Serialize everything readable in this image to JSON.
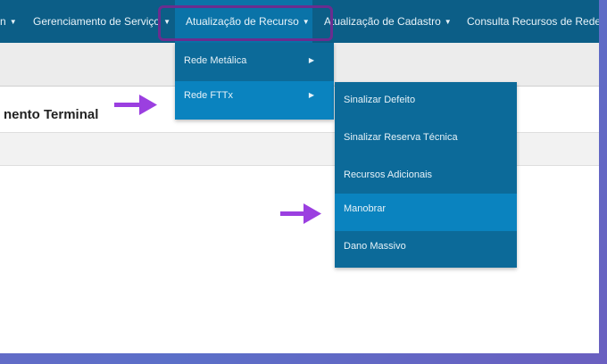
{
  "nav": {
    "items": [
      {
        "label": "n",
        "caret": "▼"
      },
      {
        "label": "Gerenciamento de Serviço",
        "caret": "▼"
      },
      {
        "label": "Atualização de Recurso",
        "caret": "▼"
      },
      {
        "label": "Atualização de Cadastro",
        "caret": "▼"
      },
      {
        "label": "Consulta Recursos de Rede",
        "caret": ""
      }
    ]
  },
  "page": {
    "title": "nento Terminal"
  },
  "menu_level1": {
    "items": [
      {
        "label": "Rede Metálica",
        "arrow": "▶"
      },
      {
        "label": "Rede FTTx",
        "arrow": "▶"
      }
    ]
  },
  "menu_level2": {
    "items": [
      {
        "label": "Sinalizar Defeito"
      },
      {
        "label": "Sinalizar Reserva Técnica"
      },
      {
        "label": "Recursos Adicionais"
      },
      {
        "label": "Manobrar"
      },
      {
        "label": "Dano Massivo"
      }
    ]
  },
  "colors": {
    "navbar": "#0c5e87",
    "menu": "#0c6a99",
    "menu_hover": "#0a83bf",
    "highlight_box": "#6b2d8f",
    "annotation_arrow": "#9b3fe0"
  },
  "annotations": {
    "arrow_icon": "right-arrow-icon"
  }
}
